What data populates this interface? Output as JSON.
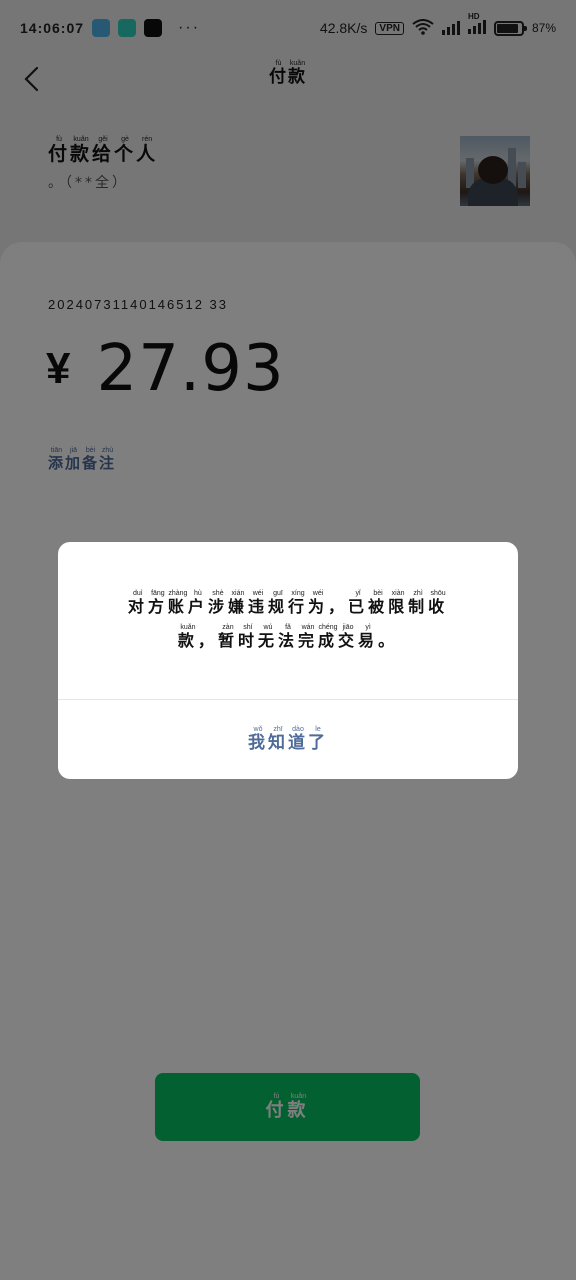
{
  "status_bar": {
    "time": "14:06:07",
    "more": "···",
    "net_speed": "42.8K/s",
    "vpn": "VPN",
    "signal_label": "HD",
    "battery": "87%",
    "battery_level": 0.87,
    "app_icons": [
      "app-notification-icon",
      "forward-app-icon",
      "tiktok-icon"
    ]
  },
  "nav": {
    "title": "付款",
    "title_pinyin": [
      "fù",
      "kuǎn"
    ]
  },
  "payee": {
    "title": "付款给个人",
    "title_pinyin": [
      "fù",
      "kuǎn",
      "gěi",
      "gè",
      "rén"
    ],
    "name": "。（**全）"
  },
  "order_number": "20240731140146512 33",
  "amount": {
    "currency": "¥",
    "value": "27.93"
  },
  "add_note": {
    "label": "添加备注",
    "pinyin": [
      "tiān",
      "jiā",
      "bèi",
      "zhù"
    ]
  },
  "pay_button": {
    "label": "付款",
    "pinyin": [
      "fù",
      "kuǎn"
    ],
    "color": "#07c160"
  },
  "dialog": {
    "line1": [
      [
        "对",
        "duì"
      ],
      [
        "方",
        "fāng"
      ],
      [
        "账",
        "zhàng"
      ],
      [
        "户",
        "hù"
      ],
      [
        "涉",
        "shè"
      ],
      [
        "嫌",
        "xián"
      ],
      [
        "违",
        "wéi"
      ],
      [
        "规",
        "guī"
      ],
      [
        "行",
        "xíng"
      ],
      [
        "为",
        "wéi"
      ],
      [
        "，",
        ""
      ],
      [
        "已",
        "yǐ"
      ],
      [
        "被",
        "bèi"
      ],
      [
        "限",
        "xiàn"
      ],
      [
        "制",
        "zhì"
      ],
      [
        "收",
        "shōu"
      ]
    ],
    "line2": [
      [
        "款",
        "kuǎn"
      ],
      [
        "，",
        ""
      ],
      [
        "暂",
        "zàn"
      ],
      [
        "时",
        "shí"
      ],
      [
        "无",
        "wú"
      ],
      [
        "法",
        "fǎ"
      ],
      [
        "完",
        "wán"
      ],
      [
        "成",
        "chéng"
      ],
      [
        "交",
        "jiāo"
      ],
      [
        "易",
        "yì"
      ],
      [
        "。",
        ""
      ]
    ],
    "button": "我知道了",
    "button_pinyin": [
      "wǒ",
      "zhī",
      "dào",
      "le"
    ],
    "accent": "#4f6b99"
  }
}
